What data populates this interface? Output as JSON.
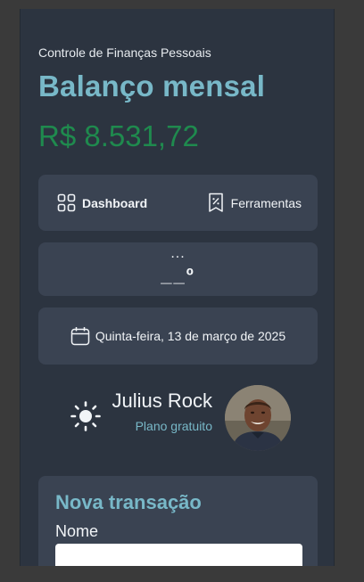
{
  "header": {
    "subtitle": "Controle de Finanças Pessoais",
    "title": "Balanço mensal",
    "balance": "R$ 8.531,72"
  },
  "nav": {
    "dashboard_label": "Dashboard",
    "tools_label": "Ferramentas",
    "dashboard_icon": "grid-icon",
    "tools_icon": "receipt-percent-icon"
  },
  "clock": {
    "top": "...",
    "value": "__º"
  },
  "date": {
    "icon": "calendar-icon",
    "text": "Quinta-feira, 13 de março de 2025"
  },
  "user": {
    "theme_icon": "sun-icon",
    "name": "Julius Rock",
    "plan": "Plano gratuito"
  },
  "form": {
    "title": "Nova transação",
    "name_label": "Nome",
    "name_value": ""
  },
  "colors": {
    "background": "#2c3440",
    "card": "#3a4352",
    "accent": "#78b8c8",
    "balance": "#1f8a4e"
  }
}
